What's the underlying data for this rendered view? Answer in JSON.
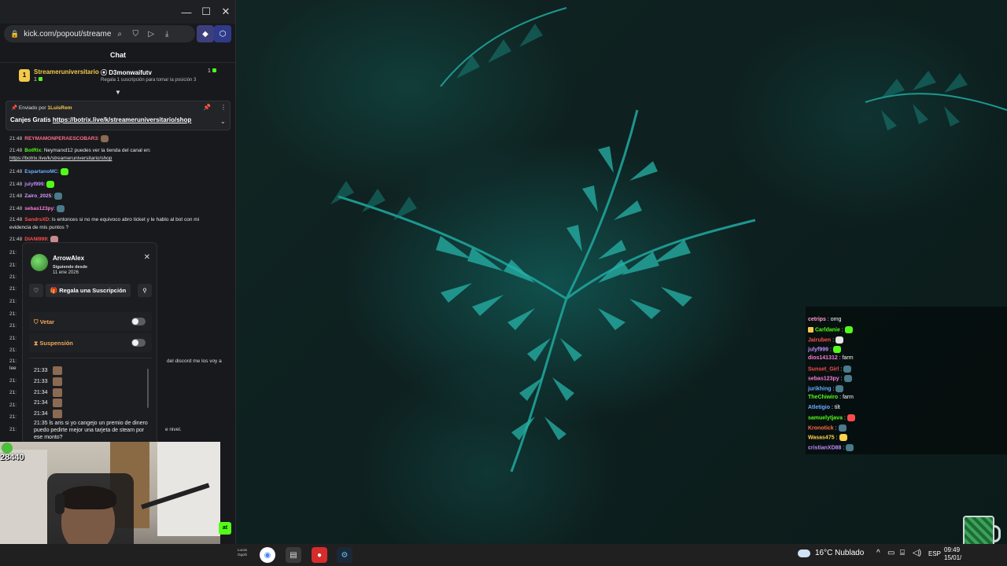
{
  "browser": {
    "url": "kick.com/popout/streameruni",
    "window_controls": {
      "minimize": "—",
      "maximize": "☐",
      "close": "✕"
    },
    "chat_title": "Chat"
  },
  "leaderboard": {
    "first": {
      "rank": "1",
      "name": "Streameruniversitario",
      "count": "1"
    },
    "second": {
      "name": "D3monwaifutv",
      "count": "1",
      "sub_text": "Regala 1 suscripción para tomar la posición 3"
    }
  },
  "pinned": {
    "sent_by_label": "Enviado por",
    "sent_by_user": "1LuisRem",
    "message_prefix": "Canjes Gratis",
    "message_link": "https://botrix.live/k/streameruniversitario/shop"
  },
  "chat": {
    "lines": [
      {
        "time": "21:48",
        "user": "REYMAMONPERAESCOBAR3",
        "color": "#ff6b8a",
        "text": ""
      },
      {
        "time": "21:48",
        "user": "BotRix",
        "color": "#53fc18",
        "text": "Neymarxd12 puedes ver la tienda del canal en:"
      },
      {
        "time": "",
        "user": "",
        "color": "#ffffff",
        "text": "https://botrix.live/k/streameruniversitario/shop"
      },
      {
        "time": "21:48",
        "user": "EspartanoMC",
        "color": "#6ab0ff",
        "text": ""
      },
      {
        "time": "21:48",
        "user": "julyf999",
        "color": "#c38bff",
        "text": ""
      },
      {
        "time": "21:48",
        "user": "Zairo_2025",
        "color": "#d69cff",
        "text": ""
      },
      {
        "time": "21:48",
        "user": "sebas123py",
        "color": "#ff7ad9",
        "text": ""
      },
      {
        "time": "21:48",
        "user": "SandrsXD",
        "color": "#ff4d4d",
        "text": "ls entonces si no me equivoco abro ticket y le hablo al bot con mi"
      },
      {
        "time": "",
        "user": "",
        "color": "#ffffff",
        "text": "evidencia de mis puntos ?"
      },
      {
        "time": "21:48",
        "user": "DIANI999",
        "color": "#ff4d4d",
        "text": ""
      }
    ],
    "side_times": [
      "21:",
      "21:",
      "21:",
      "21:",
      "21:",
      "21:",
      "21:",
      "21:",
      "21:",
      "21:",
      "21:",
      "21:",
      "21:",
      "21:",
      "21:"
    ],
    "fragments": [
      "del discord me los voy a",
      "lee",
      "e nivel."
    ]
  },
  "usercard": {
    "username": "ArrowAlex",
    "following_label": "Siguiendo desde",
    "following_date": "11 ene 2026",
    "gift_button": "Regala una Suscripción",
    "ban_label": "Vetar",
    "timeout_label": "Suspensión",
    "log_times": [
      "21:33",
      "21:33",
      "21:34",
      "21:34",
      "21:34"
    ],
    "log_message": "21:35 ls aris si yo cangejo un premio de dinero puedo pedirte mejor una tarjeta de steam por ese monto?"
  },
  "webcam": {
    "viewer_count": "28440"
  },
  "overlay_chat": {
    "lines": [
      {
        "user": "cetrips",
        "color": "#ff9bd2",
        "text": ": omg"
      },
      {
        "user": "Carldanie",
        "color": "#53fc18",
        "text": ":"
      },
      {
        "user": "Jairuben",
        "color": "#ff4d4d",
        "text": ":"
      },
      {
        "user": "julyf999",
        "color": "#c38bff",
        "text": ":"
      },
      {
        "user": "dios141312",
        "color": "#ff7ad9",
        "text": ": farm"
      },
      {
        "user": "Sunset_Girl",
        "color": "#ff4d4d",
        "text": ":"
      },
      {
        "user": "sebas123py",
        "color": "#ff7ad9",
        "text": ":"
      },
      {
        "user": "jurikhing",
        "color": "#6ab0ff",
        "text": ":"
      },
      {
        "user": "TheChiwiro",
        "color": "#53fc18",
        "text": ": farm"
      },
      {
        "user": "Atletigio",
        "color": "#6ab0ff",
        "text": ": tilt"
      },
      {
        "user": "samuelytjava",
        "color": "#53fc18",
        "text": ":"
      },
      {
        "user": "Kronotick",
        "color": "#ff6b3d",
        "text": ":"
      },
      {
        "user": "Wasas475",
        "color": "#ffd24d",
        "text": ":"
      },
      {
        "user": "cristianXD88",
        "color": "#c38bff",
        "text": ":"
      }
    ]
  },
  "taskbar": {
    "small_label": "Lucas Ogoló",
    "weather": "16°C Nublado",
    "lang": "ESP",
    "time": "09:49",
    "date": "15/01/"
  },
  "colors": {
    "kick_green": "#53fc18",
    "gold": "#f2c94c",
    "orange": "#f2a65a"
  }
}
